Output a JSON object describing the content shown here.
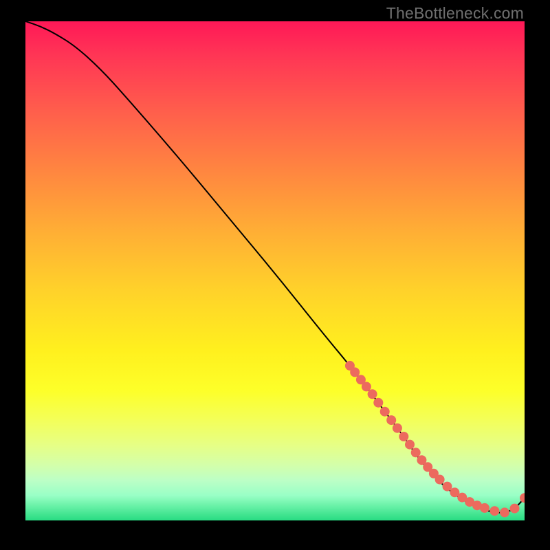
{
  "watermark": "TheBottleneck.com",
  "colors": {
    "dot": "#ec6a5e",
    "curve": "#000000"
  },
  "chart_data": {
    "type": "line",
    "title": "",
    "xlabel": "",
    "ylabel": "",
    "xlim": [
      0,
      100
    ],
    "ylim": [
      0,
      100
    ],
    "grid": false,
    "legend": false,
    "series": [
      {
        "name": "bottleneck-curve",
        "x": [
          0,
          3,
          6,
          10,
          15,
          20,
          30,
          40,
          50,
          60,
          65,
          70,
          73,
          76,
          78,
          80,
          82,
          84,
          86,
          88,
          90,
          92,
          94,
          96,
          98,
          100
        ],
        "y": [
          100,
          99,
          97.5,
          95,
          90.5,
          85,
          73.5,
          61.5,
          49.5,
          37,
          31,
          24.5,
          20.5,
          16.5,
          13.5,
          11,
          8.7,
          6.8,
          5.2,
          3.9,
          2.9,
          2.1,
          1.6,
          1.5,
          2.3,
          4.5
        ]
      }
    ],
    "highlight_points": {
      "name": "data-dots",
      "x": [
        65.0,
        66.0,
        67.2,
        68.3,
        69.5,
        70.7,
        72.0,
        73.3,
        74.5,
        75.8,
        77.0,
        78.2,
        79.4,
        80.6,
        81.8,
        83.0,
        84.5,
        86.0,
        87.5,
        89.0,
        90.5,
        92.0,
        94.0,
        96.0,
        98.0,
        100.0
      ],
      "y": [
        31.0,
        29.7,
        28.2,
        26.8,
        25.3,
        23.6,
        21.8,
        20.1,
        18.5,
        16.8,
        15.2,
        13.6,
        12.1,
        10.7,
        9.4,
        8.2,
        6.8,
        5.6,
        4.6,
        3.7,
        3.0,
        2.5,
        1.9,
        1.6,
        2.4,
        4.5
      ]
    }
  }
}
